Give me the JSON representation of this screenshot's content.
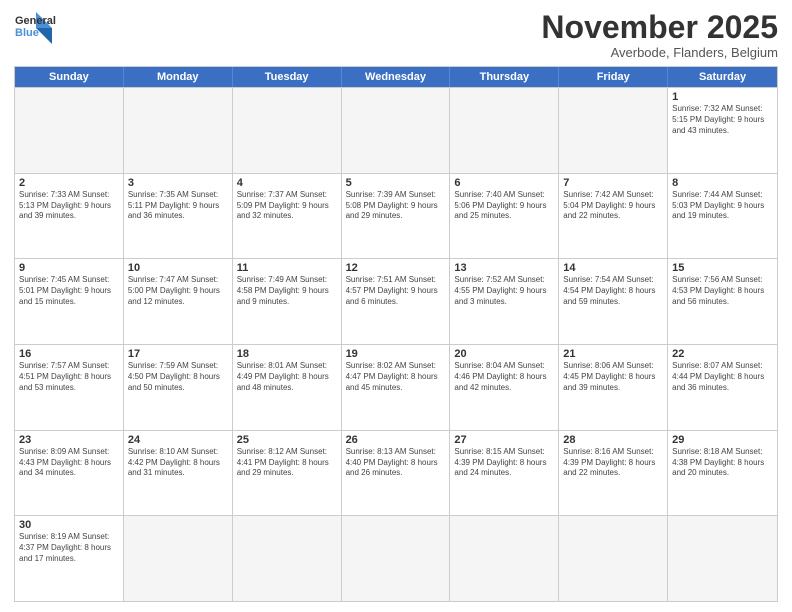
{
  "header": {
    "logo_general": "General",
    "logo_blue": "Blue",
    "month_title": "November 2025",
    "subtitle": "Averbode, Flanders, Belgium"
  },
  "day_headers": [
    "Sunday",
    "Monday",
    "Tuesday",
    "Wednesday",
    "Thursday",
    "Friday",
    "Saturday"
  ],
  "weeks": [
    [
      {
        "num": "",
        "info": "",
        "empty": true
      },
      {
        "num": "",
        "info": "",
        "empty": true
      },
      {
        "num": "",
        "info": "",
        "empty": true
      },
      {
        "num": "",
        "info": "",
        "empty": true
      },
      {
        "num": "",
        "info": "",
        "empty": true
      },
      {
        "num": "",
        "info": "",
        "empty": true
      },
      {
        "num": "1",
        "info": "Sunrise: 7:32 AM\nSunset: 5:15 PM\nDaylight: 9 hours and 43 minutes."
      }
    ],
    [
      {
        "num": "2",
        "info": "Sunrise: 7:33 AM\nSunset: 5:13 PM\nDaylight: 9 hours and 39 minutes."
      },
      {
        "num": "3",
        "info": "Sunrise: 7:35 AM\nSunset: 5:11 PM\nDaylight: 9 hours and 36 minutes."
      },
      {
        "num": "4",
        "info": "Sunrise: 7:37 AM\nSunset: 5:09 PM\nDaylight: 9 hours and 32 minutes."
      },
      {
        "num": "5",
        "info": "Sunrise: 7:39 AM\nSunset: 5:08 PM\nDaylight: 9 hours and 29 minutes."
      },
      {
        "num": "6",
        "info": "Sunrise: 7:40 AM\nSunset: 5:06 PM\nDaylight: 9 hours and 25 minutes."
      },
      {
        "num": "7",
        "info": "Sunrise: 7:42 AM\nSunset: 5:04 PM\nDaylight: 9 hours and 22 minutes."
      },
      {
        "num": "8",
        "info": "Sunrise: 7:44 AM\nSunset: 5:03 PM\nDaylight: 9 hours and 19 minutes."
      }
    ],
    [
      {
        "num": "9",
        "info": "Sunrise: 7:45 AM\nSunset: 5:01 PM\nDaylight: 9 hours and 15 minutes."
      },
      {
        "num": "10",
        "info": "Sunrise: 7:47 AM\nSunset: 5:00 PM\nDaylight: 9 hours and 12 minutes."
      },
      {
        "num": "11",
        "info": "Sunrise: 7:49 AM\nSunset: 4:58 PM\nDaylight: 9 hours and 9 minutes."
      },
      {
        "num": "12",
        "info": "Sunrise: 7:51 AM\nSunset: 4:57 PM\nDaylight: 9 hours and 6 minutes."
      },
      {
        "num": "13",
        "info": "Sunrise: 7:52 AM\nSunset: 4:55 PM\nDaylight: 9 hours and 3 minutes."
      },
      {
        "num": "14",
        "info": "Sunrise: 7:54 AM\nSunset: 4:54 PM\nDaylight: 8 hours and 59 minutes."
      },
      {
        "num": "15",
        "info": "Sunrise: 7:56 AM\nSunset: 4:53 PM\nDaylight: 8 hours and 56 minutes."
      }
    ],
    [
      {
        "num": "16",
        "info": "Sunrise: 7:57 AM\nSunset: 4:51 PM\nDaylight: 8 hours and 53 minutes."
      },
      {
        "num": "17",
        "info": "Sunrise: 7:59 AM\nSunset: 4:50 PM\nDaylight: 8 hours and 50 minutes."
      },
      {
        "num": "18",
        "info": "Sunrise: 8:01 AM\nSunset: 4:49 PM\nDaylight: 8 hours and 48 minutes."
      },
      {
        "num": "19",
        "info": "Sunrise: 8:02 AM\nSunset: 4:47 PM\nDaylight: 8 hours and 45 minutes."
      },
      {
        "num": "20",
        "info": "Sunrise: 8:04 AM\nSunset: 4:46 PM\nDaylight: 8 hours and 42 minutes."
      },
      {
        "num": "21",
        "info": "Sunrise: 8:06 AM\nSunset: 4:45 PM\nDaylight: 8 hours and 39 minutes."
      },
      {
        "num": "22",
        "info": "Sunrise: 8:07 AM\nSunset: 4:44 PM\nDaylight: 8 hours and 36 minutes."
      }
    ],
    [
      {
        "num": "23",
        "info": "Sunrise: 8:09 AM\nSunset: 4:43 PM\nDaylight: 8 hours and 34 minutes."
      },
      {
        "num": "24",
        "info": "Sunrise: 8:10 AM\nSunset: 4:42 PM\nDaylight: 8 hours and 31 minutes."
      },
      {
        "num": "25",
        "info": "Sunrise: 8:12 AM\nSunset: 4:41 PM\nDaylight: 8 hours and 29 minutes."
      },
      {
        "num": "26",
        "info": "Sunrise: 8:13 AM\nSunset: 4:40 PM\nDaylight: 8 hours and 26 minutes."
      },
      {
        "num": "27",
        "info": "Sunrise: 8:15 AM\nSunset: 4:39 PM\nDaylight: 8 hours and 24 minutes."
      },
      {
        "num": "28",
        "info": "Sunrise: 8:16 AM\nSunset: 4:39 PM\nDaylight: 8 hours and 22 minutes."
      },
      {
        "num": "29",
        "info": "Sunrise: 8:18 AM\nSunset: 4:38 PM\nDaylight: 8 hours and 20 minutes."
      }
    ],
    [
      {
        "num": "30",
        "info": "Sunrise: 8:19 AM\nSunset: 4:37 PM\nDaylight: 8 hours and 17 minutes."
      },
      {
        "num": "",
        "info": "",
        "empty": true
      },
      {
        "num": "",
        "info": "",
        "empty": true
      },
      {
        "num": "",
        "info": "",
        "empty": true
      },
      {
        "num": "",
        "info": "",
        "empty": true
      },
      {
        "num": "",
        "info": "",
        "empty": true
      },
      {
        "num": "",
        "info": "",
        "empty": true
      }
    ]
  ]
}
